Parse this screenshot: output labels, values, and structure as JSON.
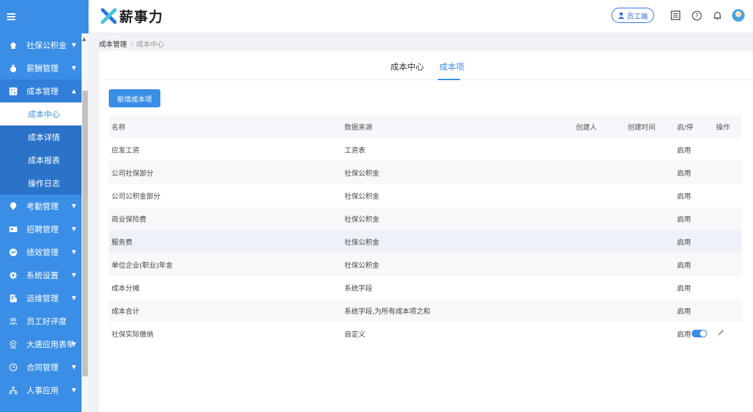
{
  "app": {
    "logo_text": "薪事力"
  },
  "header": {
    "employee_button": "员工端"
  },
  "sidebar": {
    "items": [
      {
        "label": "社保公积金",
        "icon": "home-icon"
      },
      {
        "label": "薪酬管理",
        "icon": "money-bag-icon"
      },
      {
        "label": "成本管理",
        "icon": "calculator-icon"
      },
      {
        "label": "考勤管理",
        "icon": "location-icon"
      },
      {
        "label": "招聘管理",
        "icon": "recruit-icon"
      },
      {
        "label": "绩效管理",
        "icon": "performance-icon"
      },
      {
        "label": "系统设置",
        "icon": "gear-icon"
      },
      {
        "label": "运维管理",
        "icon": "document-icon"
      },
      {
        "label": "员工好评度",
        "icon": "people-icon"
      },
      {
        "label": "大唐应用表单",
        "icon": "form-icon"
      },
      {
        "label": "合同管理",
        "icon": "clock-icon"
      },
      {
        "label": "人事应用",
        "icon": "org-icon"
      }
    ],
    "submenu": [
      "成本中心",
      "成本详情",
      "成本报表",
      "操作日志"
    ]
  },
  "breadcrumb": {
    "parent": "成本管理",
    "separator": "/",
    "current": "成本中心"
  },
  "tabs": [
    "成本中心",
    "成本项"
  ],
  "add_button": "新增成本项",
  "table": {
    "headers": [
      "名称",
      "数据来源",
      "创建人",
      "创建时间",
      "启/停",
      "操作"
    ],
    "rows": [
      {
        "name": "应发工资",
        "source": "工资表",
        "creator": "",
        "time": "",
        "status": "启用"
      },
      {
        "name": "公司社保部分",
        "source": "社保公积金",
        "creator": "",
        "time": "",
        "status": "启用"
      },
      {
        "name": "公司公积金部分",
        "source": "社保公积金",
        "creator": "",
        "time": "",
        "status": "启用"
      },
      {
        "name": "商业保险费",
        "source": "社保公积金",
        "creator": "",
        "time": "",
        "status": "启用"
      },
      {
        "name": "服务费",
        "source": "社保公积金",
        "creator": "",
        "time": "",
        "status": "启用"
      },
      {
        "name": "单位企业(职业)年金",
        "source": "社保公积金",
        "creator": "",
        "time": "",
        "status": "启用"
      },
      {
        "name": "成本分摊",
        "source": "系统字段",
        "creator": "",
        "time": "",
        "status": "启用"
      },
      {
        "name": "成本合计",
        "source": "系统字段,为所有成本项之和",
        "creator": "",
        "time": "",
        "status": "启用"
      },
      {
        "name": "社保实际缴纳",
        "source": "自定义",
        "creator": "",
        "time": "",
        "status": "启用"
      }
    ]
  },
  "colors": {
    "primary": "#3a8ee6",
    "sidebar_bg": "#3a8ee6",
    "submenu_bg": "#2a73c9"
  }
}
